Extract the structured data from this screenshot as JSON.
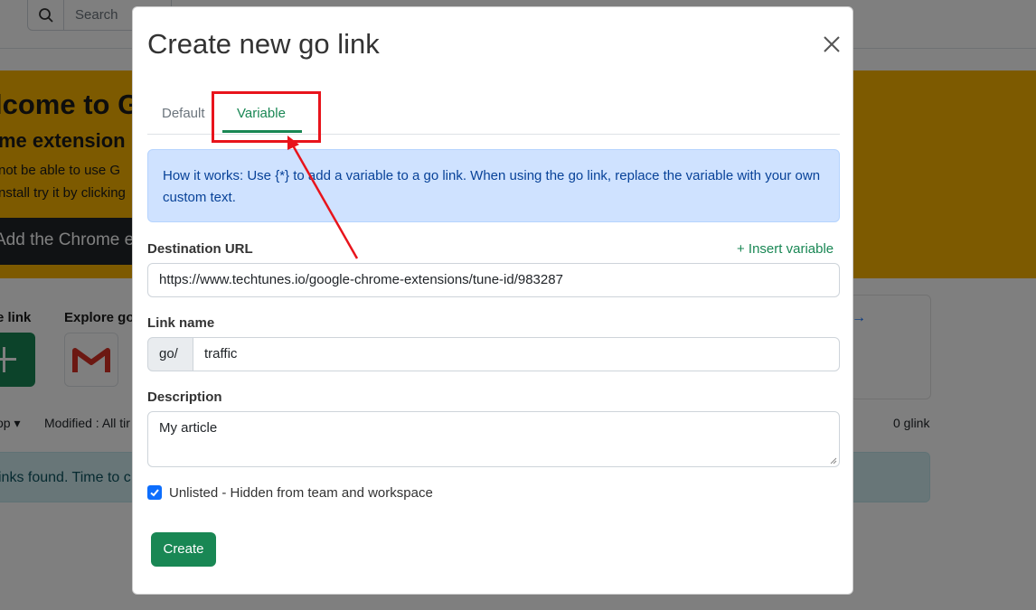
{
  "background": {
    "search": {
      "placeholder": "Search"
    },
    "banner": {
      "title": "lcome to G",
      "subtitle": "me extension",
      "line1": "not be able to use G",
      "line2": "nstall try it by clicking",
      "button": "Add the Chrome e"
    },
    "create_label": "e link",
    "explore_label": "Explore go",
    "arrow": "→",
    "filters": {
      "app": "op ▾",
      "modified": "Modified : All tir"
    },
    "count": "0 glink",
    "empty_message": "inks found. Time to c"
  },
  "modal": {
    "title": "Create new go link",
    "tabs": [
      {
        "label": "Default",
        "active": false
      },
      {
        "label": "Variable",
        "active": true
      }
    ],
    "info": "How it works: Use {*} to add a variable to a go link. When using the go link, replace the variable with your own custom text.",
    "destination": {
      "label": "Destination URL",
      "insert_variable": "+ Insert variable",
      "value": "https://www.techtunes.io/google-chrome-extensions/tune-id/983287"
    },
    "link_name": {
      "label": "Link name",
      "prefix": "go/",
      "value": "traffic"
    },
    "description": {
      "label": "Description",
      "value": "My article"
    },
    "unlisted": {
      "label": "Unlisted - Hidden from team and workspace",
      "checked": true
    },
    "create_button": "Create"
  },
  "colors": {
    "accent_green": "#198754",
    "banner_yellow": "#fbb500",
    "info_bg": "#cfe2ff",
    "checkbox_blue": "#0d6efd",
    "annotation_red": "#e8141c"
  }
}
